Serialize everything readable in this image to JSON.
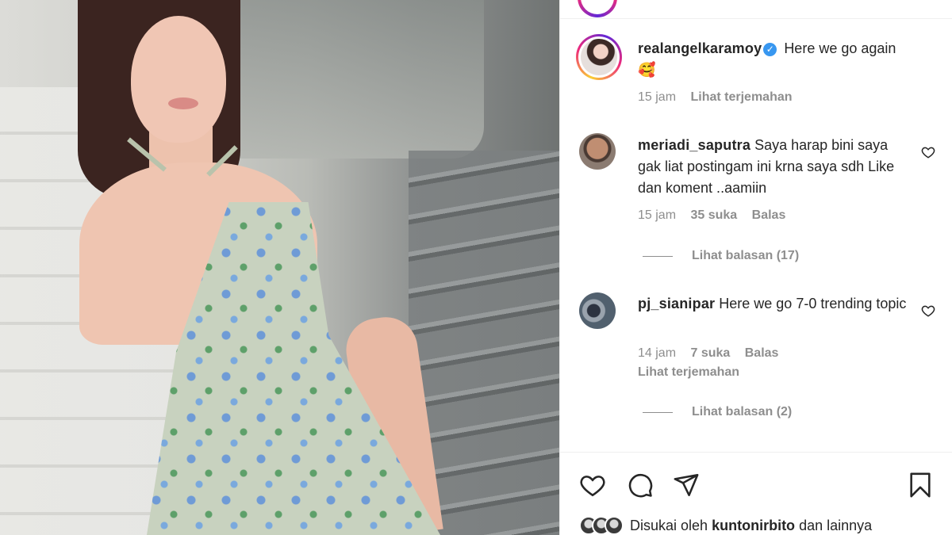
{
  "post": {
    "caption": {
      "username": "realangelkaramoy",
      "verified_icon": "verified-badge-icon",
      "text": "Here we go again 🥰",
      "time": "15 jam",
      "translate": "Lihat terjemahan"
    },
    "comments": [
      {
        "username": "meriadi_saputra",
        "text": "Saya harap bini saya gak liat postingam ini krna saya sdh Like dan koment ..aamiin",
        "time": "15 jam",
        "likes": "35 suka",
        "reply": "Balas",
        "view_replies": "Lihat balasan (17)"
      },
      {
        "username": "pj_sianipar",
        "text": "Here we go 7-0 trending topic",
        "time": "14 jam",
        "likes": "7 suka",
        "reply": "Balas",
        "translate": "Lihat terjemahan",
        "view_replies": "Lihat balasan (2)"
      }
    ],
    "actions": {
      "like_icon": "heart-icon",
      "comment_icon": "comment-icon",
      "share_icon": "send-icon",
      "save_icon": "bookmark-icon"
    },
    "liked_by": {
      "prefix": "Disukai oleh",
      "user": "kuntonirbito",
      "suffix": "dan lainnya"
    }
  },
  "colors": {
    "text": "#262626",
    "muted": "#8e8e8e",
    "verified": "#3897f0",
    "divider": "#efefef"
  }
}
